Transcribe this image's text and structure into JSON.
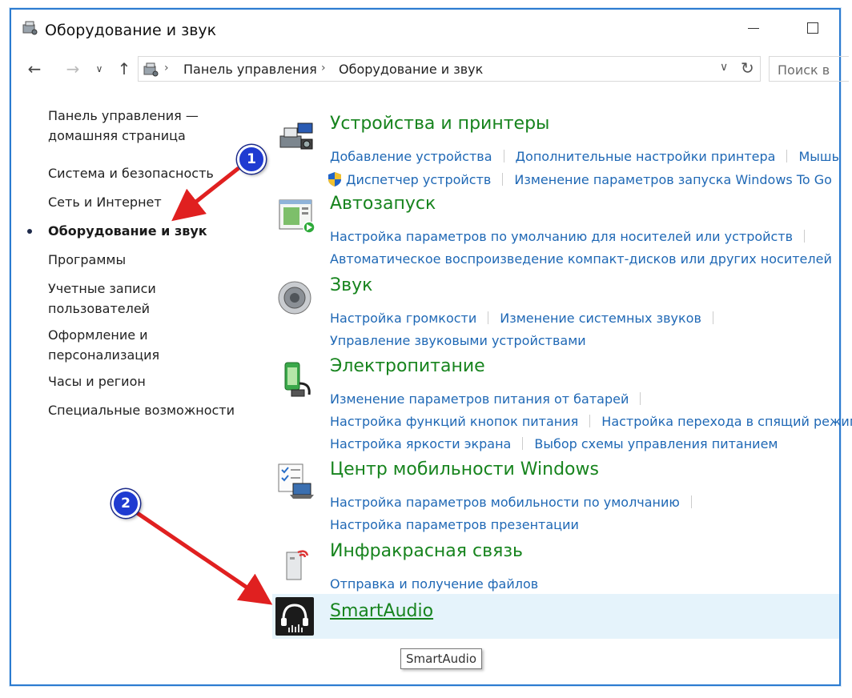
{
  "window": {
    "title": "Оборудование и звук"
  },
  "nav": {
    "breadcrumbs": [
      "Панель управления",
      "Оборудование и звук"
    ],
    "search_placeholder": "Поиск в"
  },
  "sidebar": {
    "items": [
      {
        "label_line1": "Панель управления —",
        "label_line2": "домашняя страница"
      },
      {
        "label_line1": "Система и безопасность"
      },
      {
        "label_line1": "Сеть и Интернет"
      },
      {
        "label_line1": "Оборудование и звук",
        "active": true
      },
      {
        "label_line1": "Программы"
      },
      {
        "label_line1": "Учетные записи",
        "label_line2": "пользователей"
      },
      {
        "label_line1": "Оформление и",
        "label_line2": "персонализация"
      },
      {
        "label_line1": "Часы и регион"
      },
      {
        "label_line1": "Специальные возможности"
      }
    ]
  },
  "categories": {
    "devices": {
      "title": "Устройства и принтеры",
      "links": [
        "Добавление устройства",
        "Дополнительные настройки принтера",
        "Мышь",
        "Диспетчер устройств",
        "Изменение параметров запуска Windows To Go"
      ],
      "icon": "devices-printer-icon"
    },
    "autoplay": {
      "title": "Автозапуск",
      "links": [
        "Настройка параметров по умолчанию для носителей или устройств",
        "Автоматическое воспроизведение компакт-дисков или других носителей"
      ],
      "icon": "autoplay-icon"
    },
    "sound": {
      "title": "Звук",
      "links": [
        "Настройка громкости",
        "Изменение системных звуков",
        "Управление звуковыми устройствами"
      ],
      "icon": "speaker-icon"
    },
    "power": {
      "title": "Электропитание",
      "links": [
        "Изменение параметров питания от батарей",
        "Настройка функций кнопок питания",
        "Настройка перехода в спящий режим",
        "Настройка яркости экрана",
        "Выбор схемы управления питанием"
      ],
      "icon": "power-plug-icon"
    },
    "mobility": {
      "title": "Центр мобильности Windows",
      "links": [
        "Настройка параметров мобильности по умолчанию",
        "Настройка параметров презентации"
      ],
      "icon": "mobility-laptop-icon"
    },
    "infrared": {
      "title": "Инфракрасная связь",
      "links": [
        "Отправка и получение файлов"
      ],
      "icon": "infrared-icon"
    },
    "smartaudio": {
      "title": "SmartAudio",
      "tooltip": "SmartAudio",
      "icon": "headphones-icon"
    }
  },
  "annotations": {
    "badge1": "1",
    "badge2": "2"
  },
  "colors": {
    "category_title": "#17841e",
    "link": "#1f68b5",
    "hover_row": "#e5f3fb",
    "arrow": "#e02020",
    "badge": "#1f3bd1"
  }
}
